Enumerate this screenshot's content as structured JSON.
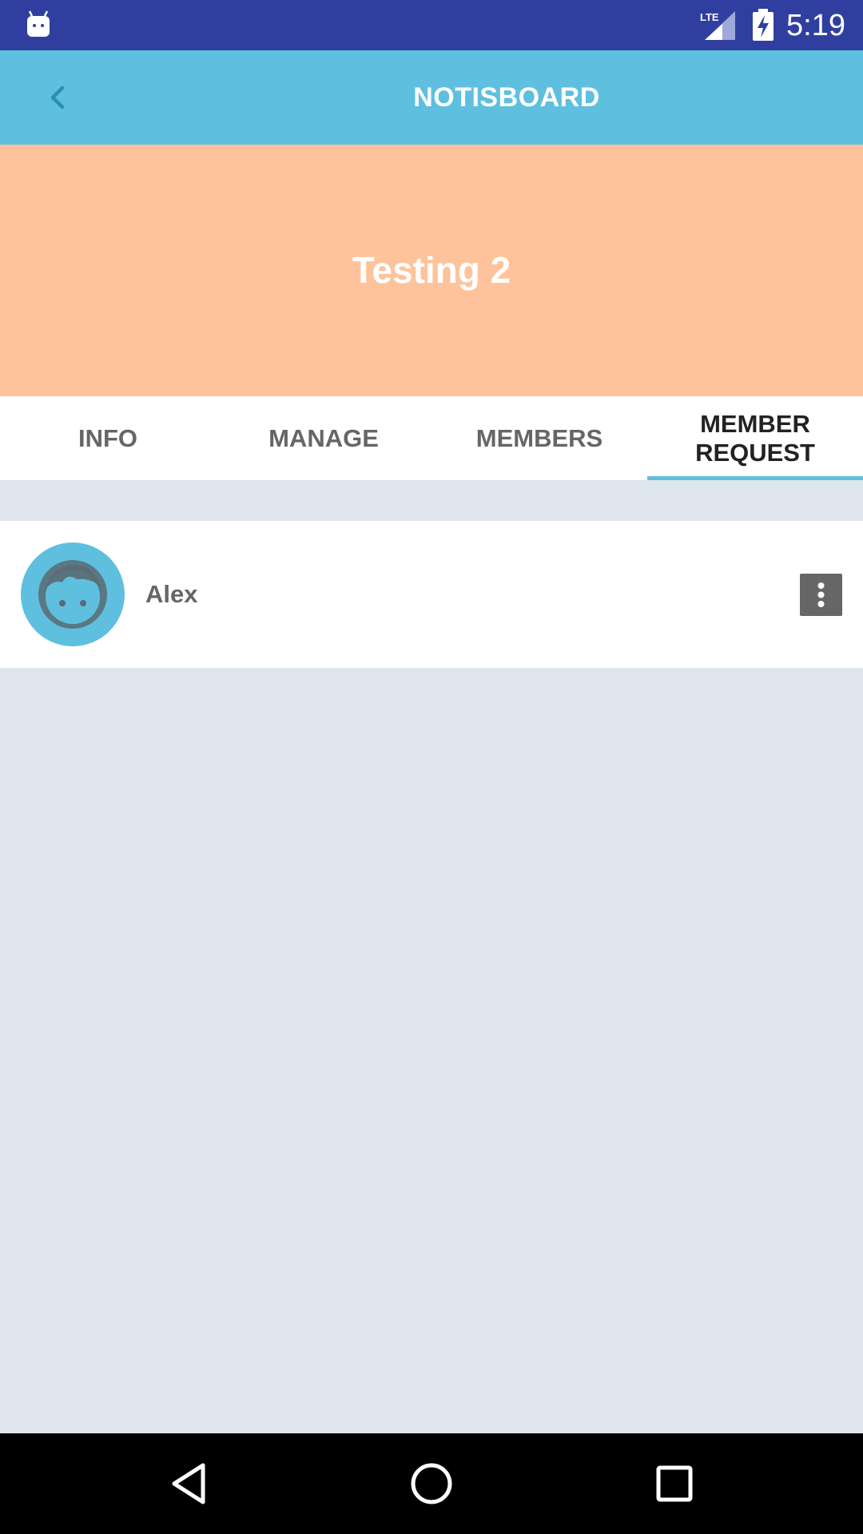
{
  "status_bar": {
    "time": "5:19",
    "network_label": "LTE",
    "icons": [
      "android-icon",
      "lte-signal-icon",
      "battery-charging-icon"
    ]
  },
  "toolbar": {
    "back_icon": "chevron-left-icon",
    "title": "NOTISBOARD"
  },
  "banner": {
    "group_name": "Testing 2"
  },
  "tabs": [
    {
      "label": "INFO",
      "active": false
    },
    {
      "label": "MANAGE",
      "active": false
    },
    {
      "label": "MEMBERS",
      "active": false
    },
    {
      "label": "MEMBER\nREQUEST",
      "active": true
    }
  ],
  "member_requests": [
    {
      "name": "Alex",
      "avatar_icon": "user-face-icon",
      "menu_icon": "more-vertical-icon"
    }
  ],
  "nav_bar": {
    "icons": [
      "back-triangle-icon",
      "home-circle-icon",
      "recents-square-icon"
    ]
  },
  "colors": {
    "status_bar": "#303f9f",
    "toolbar": "#5ec0de",
    "banner": "#fec39b",
    "background": "#dee5ec",
    "tab_indicator": "#5ec0de",
    "tab_inactive_text": "#666666",
    "tab_active_text": "#222222"
  }
}
